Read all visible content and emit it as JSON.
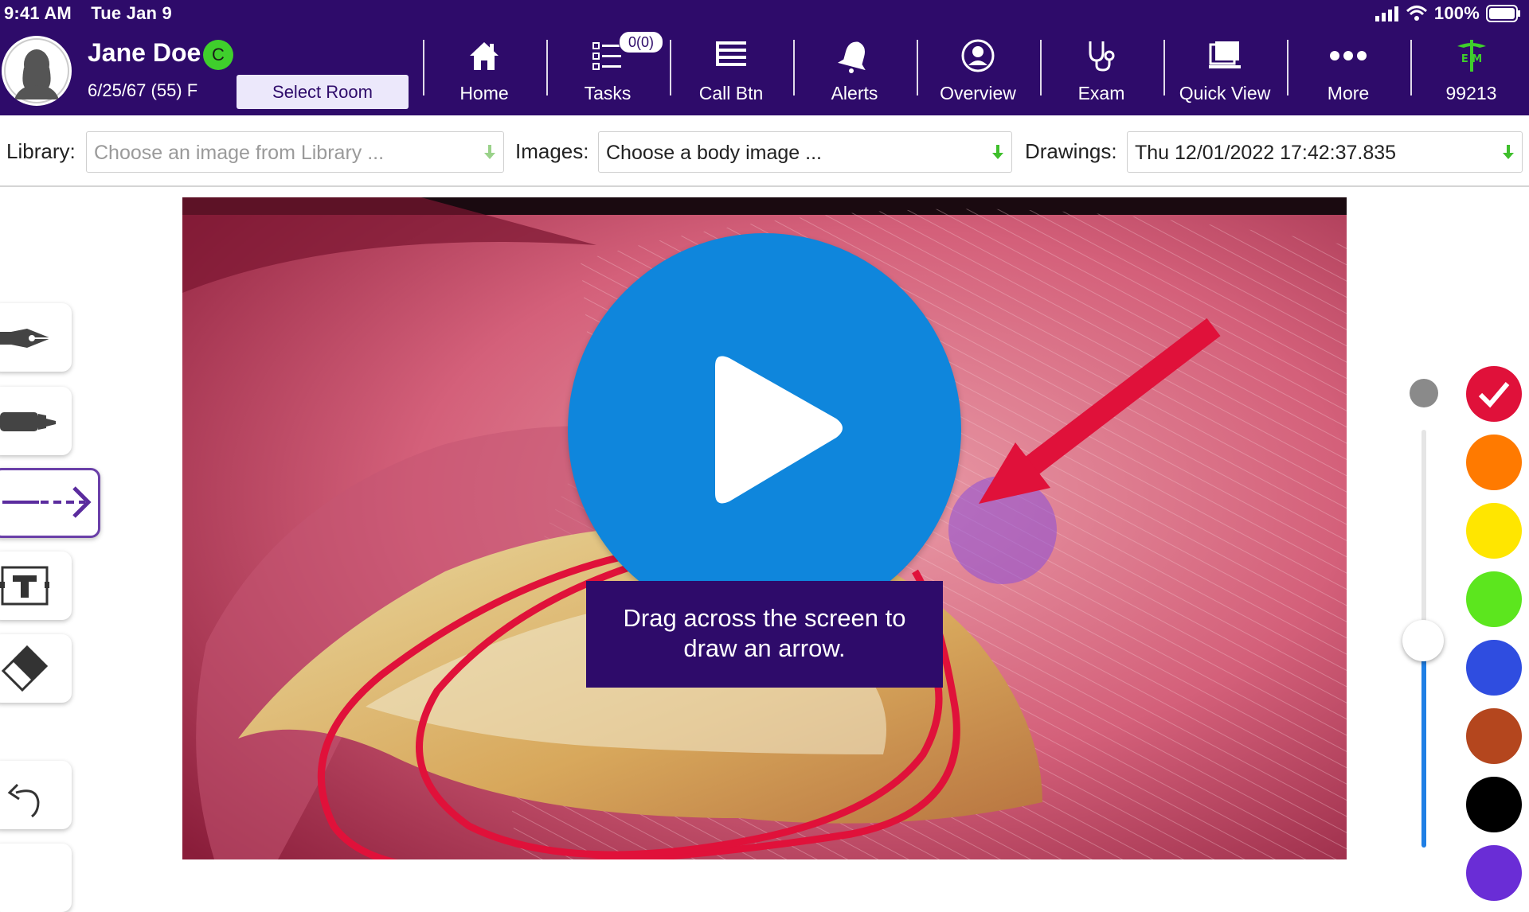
{
  "status_bar": {
    "time": "9:41 AM",
    "date": "Tue Jan 9",
    "battery": "100%"
  },
  "patient": {
    "name": "Jane Doe",
    "badge": "C",
    "info": "6/25/67 (55) F",
    "select_room_label": "Select Room"
  },
  "nav": {
    "home": "Home",
    "tasks": "Tasks",
    "tasks_badge": "0(0)",
    "call_btn": "Call Btn",
    "alerts": "Alerts",
    "overview": "Overview",
    "exam": "Exam",
    "quick_view": "Quick View",
    "more": "More",
    "em_code": "99213"
  },
  "selectors": {
    "library_label": "Library:",
    "library_placeholder": "Choose an image from Library ...",
    "images_label": "Images:",
    "images_value": "Choose a body image ...",
    "drawings_label": "Drawings:",
    "drawings_value": "Thu 12/01/2022 17:42:37.835"
  },
  "tools": {
    "icons": [
      "pen-icon",
      "marker-icon",
      "arrow-tool-icon",
      "text-tool-icon",
      "eraser-icon",
      "undo-icon"
    ],
    "active": "arrow-tool-icon"
  },
  "tooltip": {
    "line1": "Drag across the screen to",
    "line2": "draw an arrow."
  },
  "colors": {
    "header": "#2e0b6a",
    "swatches": [
      "#e0113a",
      "#ff7a00",
      "#ffe600",
      "#5ce61e",
      "#2f4de0",
      "#b4461e",
      "#000000"
    ],
    "selected_swatch": "#e0113a",
    "play_button": "#0f86dc",
    "annotation": "#e0113a"
  },
  "stroke_size_level": 0.5
}
